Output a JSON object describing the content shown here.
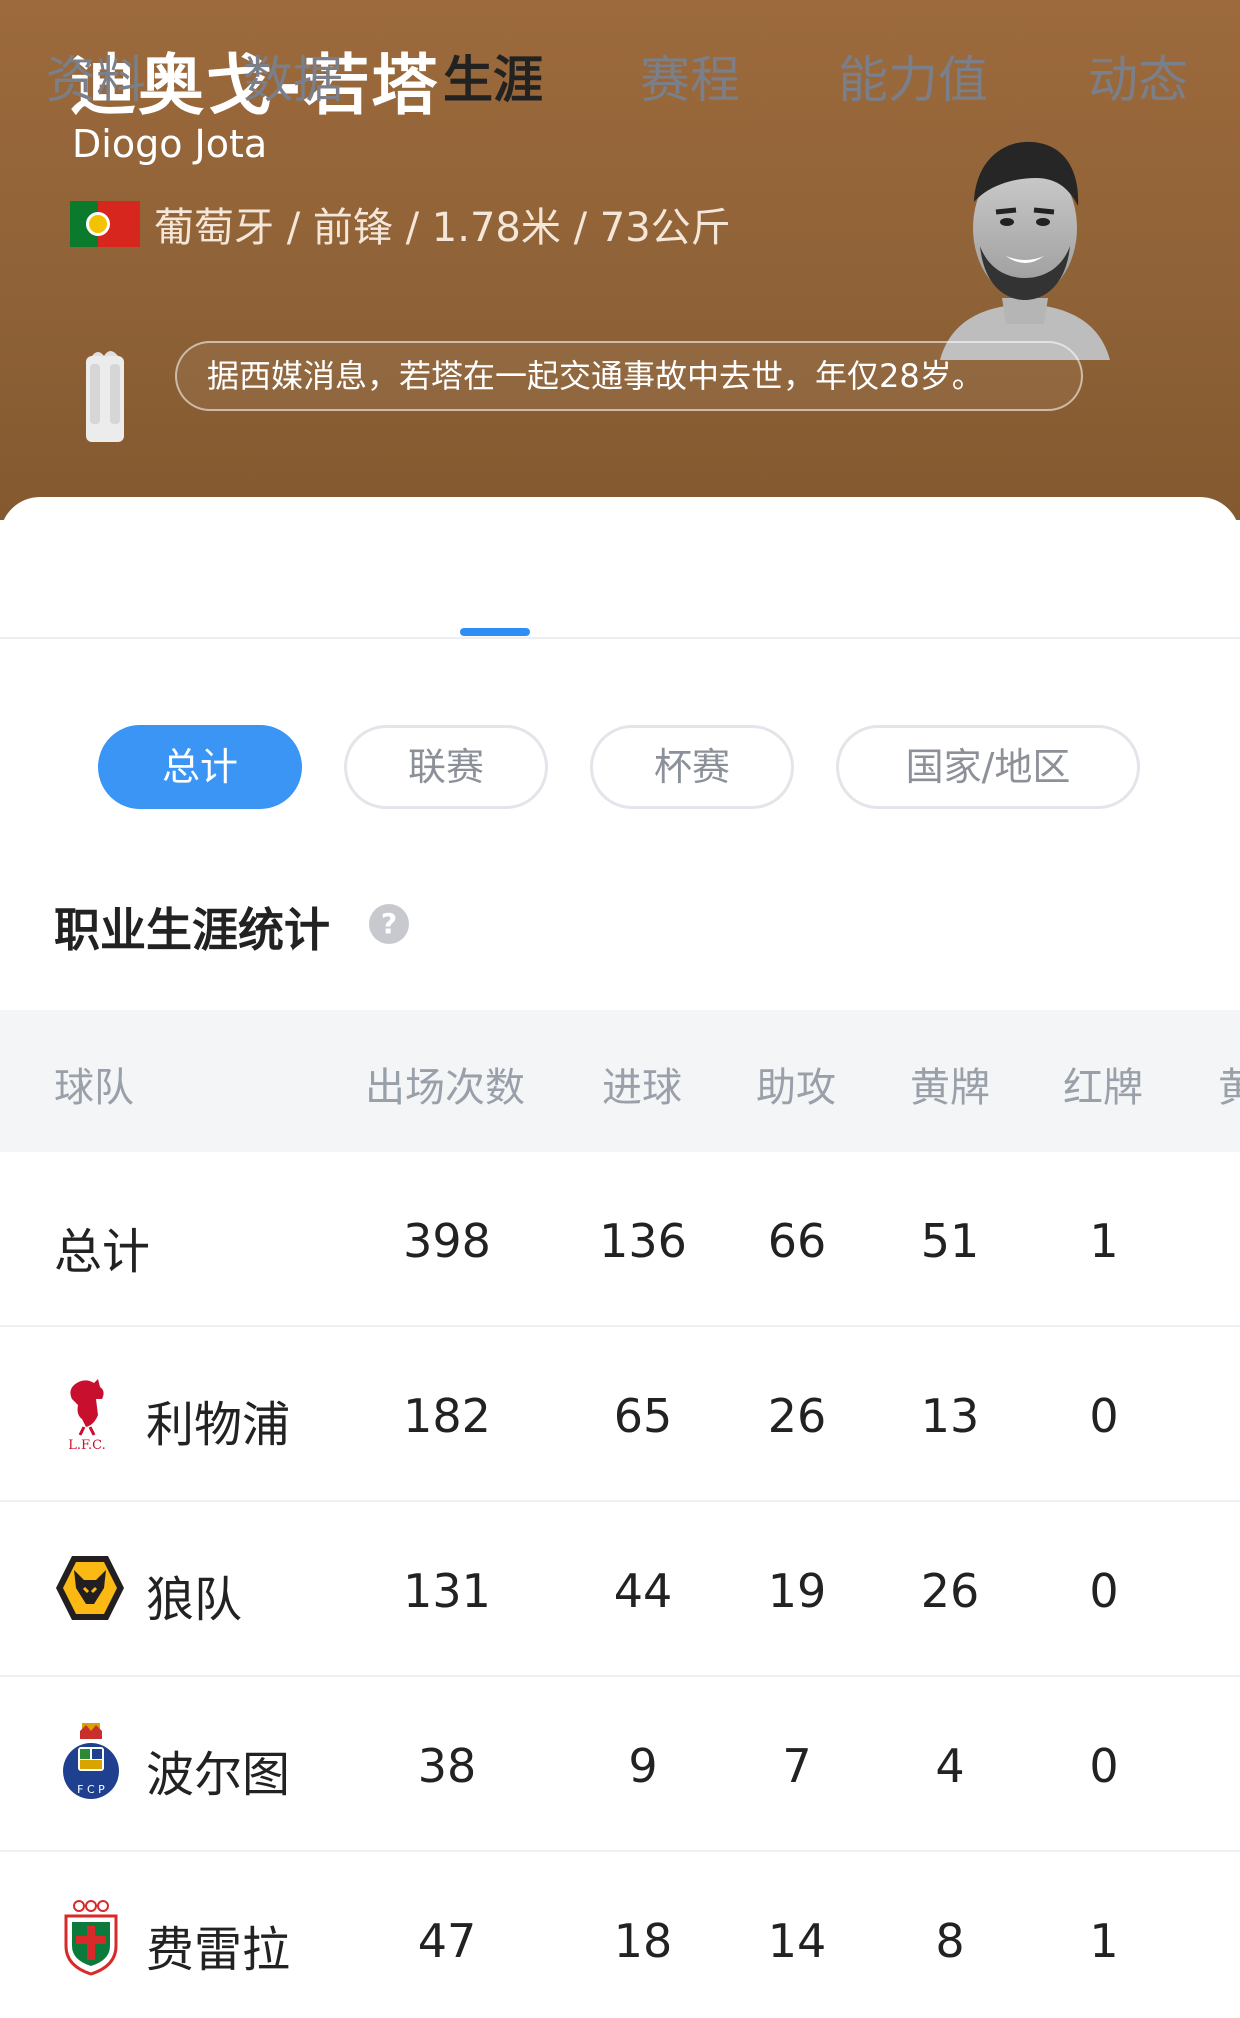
{
  "player": {
    "name_cn": "迪奥戈-若塔",
    "name_en": "Diogo Jota",
    "meta": "葡萄牙 / 前锋 / 1.78米 / 73公斤",
    "news": "据西媒消息，若塔在一起交通事故中去世，年仅28岁。"
  },
  "tabs": [
    "资料",
    "数据",
    "生涯",
    "赛程",
    "能力值",
    "动态"
  ],
  "active_tab": "生涯",
  "filters": [
    "总计",
    "联赛",
    "杯赛",
    "国家/地区"
  ],
  "active_filter": "总计",
  "section_title": "职业生涯统计",
  "table": {
    "columns": [
      "球队",
      "出场次数",
      "进球",
      "助攻",
      "黄牌",
      "红牌",
      "黄"
    ],
    "rows": [
      {
        "team": "总计",
        "apps": "398",
        "goals": "136",
        "assists": "66",
        "yellow": "51",
        "red": "1"
      },
      {
        "team": "利物浦",
        "apps": "182",
        "goals": "65",
        "assists": "26",
        "yellow": "13",
        "red": "0"
      },
      {
        "team": "狼队",
        "apps": "131",
        "goals": "44",
        "assists": "19",
        "yellow": "26",
        "red": "0"
      },
      {
        "team": "波尔图",
        "apps": "38",
        "goals": "9",
        "assists": "7",
        "yellow": "4",
        "red": "0"
      },
      {
        "team": "费雷拉",
        "apps": "47",
        "goals": "18",
        "assists": "14",
        "yellow": "8",
        "red": "1"
      }
    ]
  },
  "icons": {
    "flag": "portugal-flag-icon",
    "candle": "candle-icon",
    "help": "help-icon",
    "crests": [
      "liverpool-crest-icon",
      "wolves-crest-icon",
      "porto-crest-icon",
      "pacos-ferreira-crest-icon"
    ]
  },
  "colors": {
    "hero_bg": "#93653a",
    "accent": "#3a95f5",
    "liverpool": "#c8102e",
    "wolves": "#fdb913",
    "porto": "#1f3f8f",
    "pacos": "#0b7a3b"
  }
}
